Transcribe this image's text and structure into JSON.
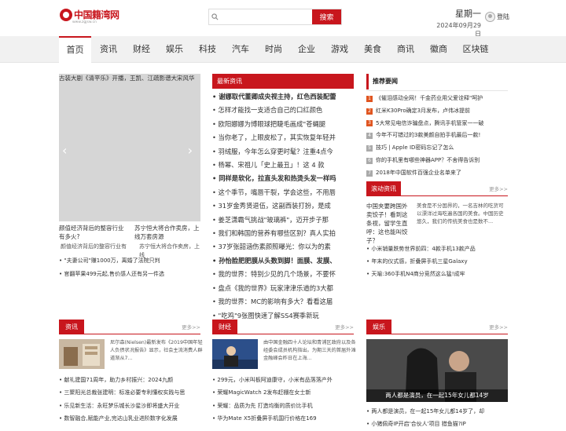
{
  "header": {
    "logo_text": "中国籍湾网",
    "logo_sub": "www.zgjsw.cn",
    "search_placeholder": "",
    "search_button": "搜索",
    "weekday": "星期一",
    "date": "2024年09月29日",
    "login": "登陆"
  },
  "nav": [
    "首页",
    "资讯",
    "财经",
    "娱乐",
    "科技",
    "汽车",
    "时尚",
    "企业",
    "游戏",
    "美食",
    "商讯",
    "徽商",
    "区块链"
  ],
  "slider": {
    "caption": "古装大剧《清平乐》开播，王凯、江疏影谱大宋风华"
  },
  "thumbs": [
    {
      "title": "颜值经济背后的整容行业有多火?",
      "note": "颜值经济背后的整容行业有"
    },
    {
      "title": "苏宁恒大将合作卖房，上线万套房源",
      "note": "苏宁恒大将合作卖房，上线"
    }
  ],
  "left_list": [
    "\"夫妻公司\"赚1000万，离婚了法院只判",
    "官翻苹果499元起,售价感人还有另一件选"
  ],
  "latest_news": {
    "title": "最新资讯",
    "items": [
      {
        "text": "谢娜取代董卿成央视主持，红色西装配蕾",
        "bold": true
      },
      {
        "text": "怎样才能找一支适合自己的口红颜色",
        "bold": false
      },
      {
        "text": "欧阳娜娜为博眼球把睫毛画成\"苍蝇腿",
        "bold": false
      },
      {
        "text": "当你老了，上眼皮松了，其实恢复年轻并",
        "bold": false
      },
      {
        "text": "羽绒服，今年怎么穿更时髦？注重4点今",
        "bold": false
      },
      {
        "text": "杨幂、宋祖儿「史上最丑」！这 4 款",
        "bold": false
      },
      {
        "text": "同样是软化，拉直头发和热烫头发一样吗",
        "bold": true
      },
      {
        "text": "这个季节，嘴唇干裂，学会这些，不用唇",
        "bold": false
      },
      {
        "text": "31岁金秀贤退伍，这副西装打扮，是成",
        "bold": false
      },
      {
        "text": "姜芝潇霸气挑战\"玻璃裤\"，迈开步子那",
        "bold": false
      },
      {
        "text": "我们和韩国的营养有哪些区别？真人实拍",
        "bold": false
      },
      {
        "text": "37岁张韶涵伤素颜照曝光：你以为的素",
        "bold": false
      },
      {
        "text": "孙怡脸肥肥膜从头数到脚！面膜、发膜、",
        "bold": true
      },
      {
        "text": "我的世界：特别少见的几个场景，不要怀",
        "bold": false
      },
      {
        "text": "盘点《我的世界》玩家津津乐道的3大都",
        "bold": false
      },
      {
        "text": "我的世界：MC的影响有多大？看看这届",
        "bold": false
      },
      {
        "text": "\"吃鸡\"9张图快速了解SS4赛季新玩",
        "bold": false
      }
    ]
  },
  "recommend": {
    "title": "推荐要闻",
    "items": [
      "《催泪感动全网！千金药业用父爱诠释\"呵护",
      "红米K30Pro确定3月发布，卢伟冰提前",
      "5大常见电信诈骗盘点，腾讯手机管家一一破",
      "今年不可错过的3款美颜自拍手机最后一款!",
      "技巧 | Apple ID密码忘记了怎么",
      "你的手机里有哪些神器APP？不舍得告诉别",
      "2018年中国软件百强企业名单来了"
    ]
  },
  "scroll_news": {
    "title": "滚动资讯",
    "more": "更多>>",
    "img_caption": "中国夹要跨国外卖饺子！看到这条视，留学生直呼：这也能叫饺子？",
    "text": "美食是不分国界的，一名吉林的吃货可以漂洋过海吃遍各国的美食。中国历史悠久，我们的传统美食也是数不...",
    "items": [
      "小米销量跌势世界前四：4款手机13款产品",
      "年末的仪式感，折叠屏手机三星Galaxy",
      "天喻:360手机N4商分竞然这么猛!成牢"
    ]
  },
  "bottom": [
    {
      "title": "资讯",
      "more": "更多>>",
      "text": "尼尔森(Nielsen)最新发布《2019中国年轻人负债状况报告》显示，社会主流消费人群道渐从7...",
      "items": [
        "献礼建国71周年，助力乡村振兴：2024九颜",
        "三聚阳光总裁张建明：标准必要专利懂权实践与思",
        "乐见新生活：永旺梦乐城长沙星沙即将盛大开业",
        "数智融合,赋能产业,完达山乳业进阶数字化发展"
      ]
    },
    {
      "title": "财经",
      "more": "更多>>",
      "text": "由中国金融四十人论坛和青浦区政府以及各经委会成员机构指出。为期三天的首届外滩金融峰会昨日在上海...",
      "items": [
        "299元，小米叫板阿迪康守，小米有品落落产外",
        "荣耀MagicWatch 2发布赶棚在女士新",
        "荣耀：品质为先 打造均衡的质价比手机",
        "华为Mate X5折叠屏手机国行价格在169"
      ]
    },
    {
      "title": "娱乐",
      "more": "更多>>",
      "photo_caption": "两人都是演员，在一起15年女儿都14岁",
      "items": [
        "两人都是演员，在一起15年女儿都14岁了，却",
        "小猪佩奇IP开启'合伙人'项目 猎鱼猫?IP"
      ]
    }
  ]
}
